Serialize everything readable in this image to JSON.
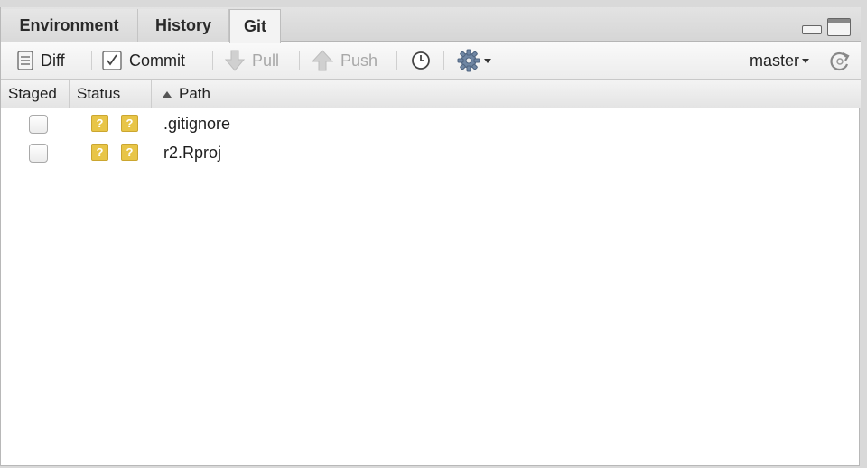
{
  "tabs": [
    {
      "label": "Environment",
      "active": false
    },
    {
      "label": "History",
      "active": false
    },
    {
      "label": "Git",
      "active": true
    }
  ],
  "toolbar": {
    "diff_label": "Diff",
    "commit_label": "Commit",
    "pull_label": "Pull",
    "push_label": "Push",
    "branch": "master"
  },
  "columns": {
    "staged": "Staged",
    "status": "Status",
    "path": "Path"
  },
  "files": [
    {
      "path": ".gitignore",
      "status_index": "?",
      "status_worktree": "?",
      "staged": false
    },
    {
      "path": "r2.Rproj",
      "status_index": "?",
      "status_worktree": "?",
      "staged": false
    }
  ],
  "colors": {
    "status_untracked": "#e8c547",
    "disabled_text": "#a8a8a8"
  },
  "icons": {
    "diff": "diff-icon",
    "commit": "commit-checkbox-icon",
    "pull": "pull-arrow-down-icon",
    "push": "push-arrow-up-icon",
    "history": "clock-icon",
    "more": "gear-icon",
    "refresh": "refresh-icon"
  }
}
